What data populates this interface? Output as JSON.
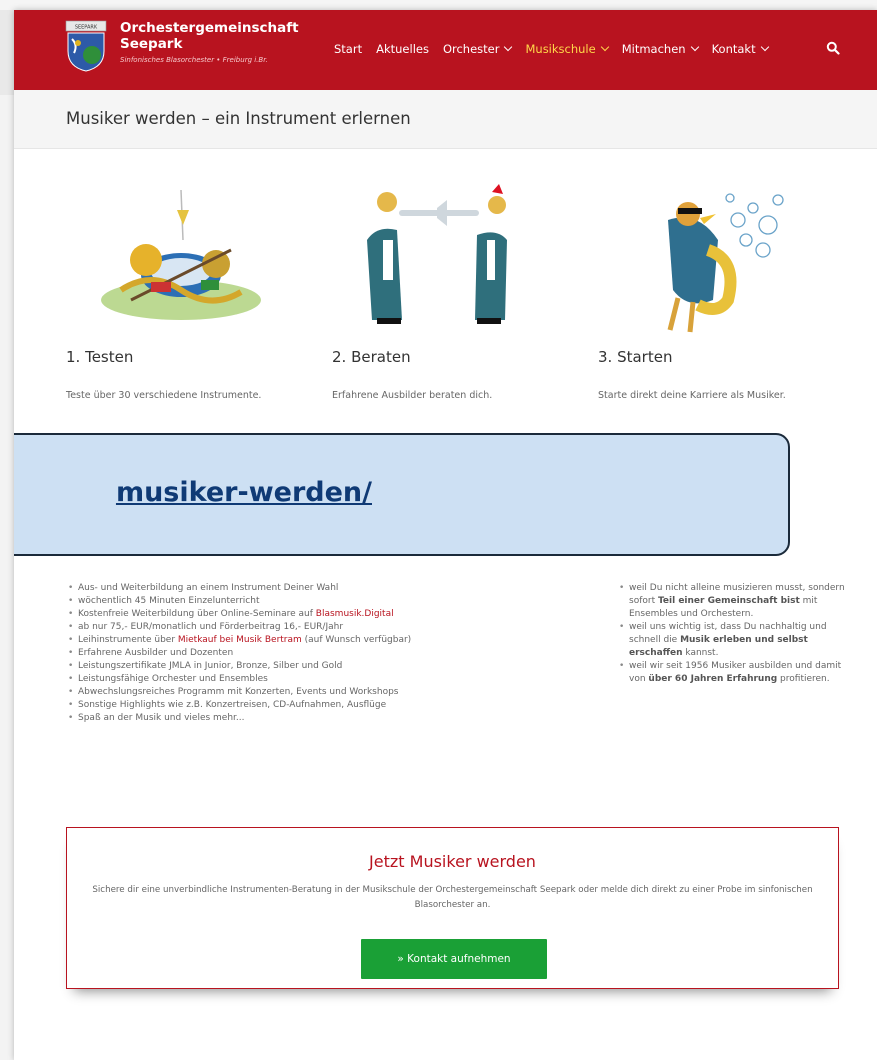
{
  "header": {
    "brand_line1": "Orchestergemeinschaft",
    "brand_line2": "Seepark",
    "brand_sub": "Sinfonisches Blasorchester • Freiburg i.Br.",
    "logo_text": "SEEPARK",
    "nav": [
      {
        "label": "Start"
      },
      {
        "label": "Aktuelles"
      },
      {
        "label": "Orchester"
      },
      {
        "label": "Musikschule",
        "active": true
      },
      {
        "label": "Mitmachen"
      },
      {
        "label": "Kontakt"
      }
    ],
    "search_icon": "search-icon"
  },
  "title": "Musiker werden – ein Instrument erlernen",
  "steps": [
    {
      "title": "1. Testen",
      "text": "Teste über 30 verschiedene Instrumente.",
      "image": "instrument-pile-illustration"
    },
    {
      "title": "2. Beraten",
      "text": "Erfahrene Ausbilder beraten dich.",
      "image": "trumpet-players-illustration"
    },
    {
      "title": "3. Starten",
      "text": "Starte direkt deine Karriere als Musiker.",
      "image": "saxophone-bird-illustration"
    }
  ],
  "url_overlay": "musiker-werden/",
  "list_left": [
    "Aus- und Weiterbildung an einem Instrument Deiner Wahl",
    "wöchentlich 45 Minuten Einzelunterricht",
    {
      "pre": "Kostenfreie Weiterbildung über Online-Seminare auf ",
      "link": "Blasmusik.Digital",
      "post": ""
    },
    "ab nur 75,- EUR/monatlich und Förderbeitrag 16,- EUR/Jahr",
    {
      "pre": "Leihinstrumente über ",
      "link": "Mietkauf bei Musik Bertram",
      "post": " (auf Wunsch verfügbar)"
    },
    "Erfahrene Ausbilder und Dozenten",
    "Leistungszertifikate JMLA in Junior, Bronze, Silber und Gold",
    "Leistungsfähige Orchester und Ensembles",
    "Abwechslungsreiches Programm mit Konzerten, Events und Workshops",
    "Sonstige Highlights wie z.B. Konzertreisen, CD-Aufnahmen, Ausflüge",
    "Spaß an der Musik und vieles mehr..."
  ],
  "list_right": [
    {
      "a": "weil Du nicht alleine musizieren musst, sondern sofort ",
      "b": "Teil einer Gemeinschaft bist",
      "c": " mit Ensembles und Orchestern."
    },
    {
      "a": "weil uns wichtig ist, dass Du nachhaltig und schnell die ",
      "b": "Musik erleben und selbst erschaffen",
      "c": " kannst."
    },
    {
      "a": "weil wir seit 1956 Musiker ausbilden und damit von ",
      "b": "über 60 Jahren Erfahrung",
      "c": " profitieren."
    }
  ],
  "cta": {
    "title": "Jetzt Musiker werden",
    "text": "Sichere dir eine unverbindliche Instrumenten-Beratung in der Musikschule der Orchestergemeinschaft Seepark oder melde dich direkt zu einer Probe im sinfonischen Blasorchester an.",
    "button": "» Kontakt aufnehmen"
  },
  "colors": {
    "brand_red": "#b8131f",
    "nav_active": "#ffd84a",
    "cta_green": "#1aa036",
    "overlay_bg": "#cde0f3"
  }
}
